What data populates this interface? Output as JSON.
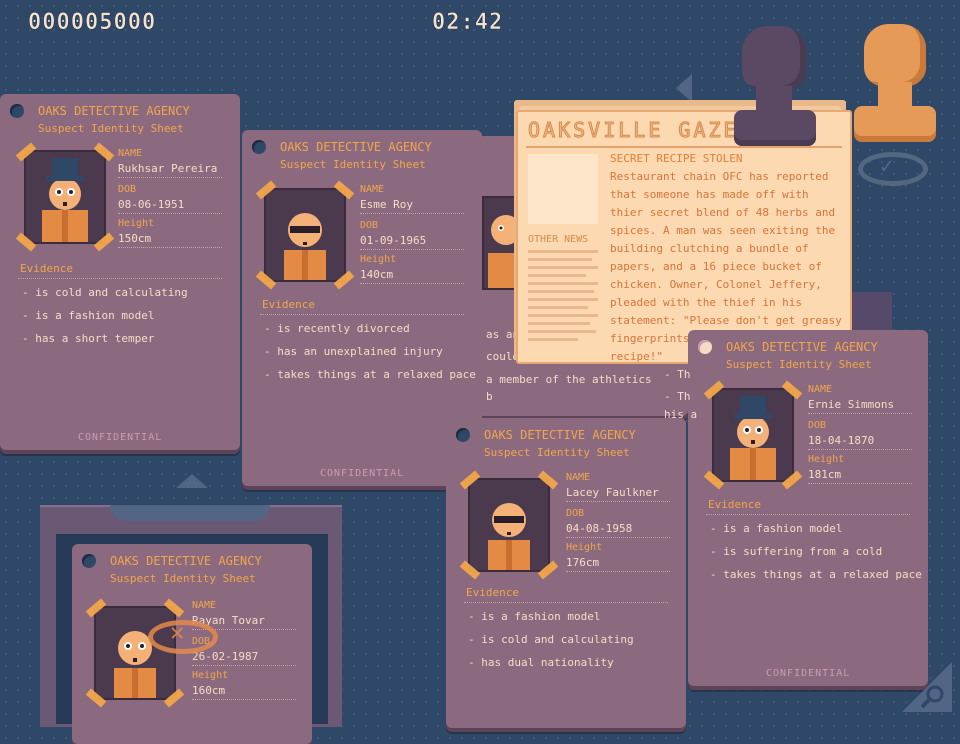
{
  "hud": {
    "score": "000005000",
    "timer": "02:42"
  },
  "colors": {
    "background": "#2f4868",
    "card": "#8b6a80",
    "accent": "#f2a64a",
    "paper": "#fcd9b0"
  },
  "field_labels": {
    "name": "NAME",
    "dob": "DOB",
    "height": "Height",
    "evidence": "Evidence",
    "confidential": "CONFIDENTIAL"
  },
  "cards": [
    {
      "agency": "OAKS DETECTIVE AGENCY",
      "subtitle": "Suspect Identity Sheet",
      "name": "Rukhsar Pereira",
      "dob": "08-06-1951",
      "height": "150cm",
      "evidence": [
        "- is cold and calculating",
        "- is a fashion model",
        "- has a short temper"
      ],
      "suspect": "top-hat"
    },
    {
      "agency": "OAKS DETECTIVE AGENCY",
      "subtitle": "Suspect Identity Sheet",
      "name": "Esme Roy",
      "dob": "01-09-1965",
      "height": "140cm",
      "evidence": [
        "- is recently divorced",
        "- has an unexplained injury",
        "- takes things at a relaxed pace"
      ],
      "suspect": "sunglasses"
    },
    {
      "agency": "OAKS DETECTIVE AGENCY",
      "subtitle": "Suspect Identity Sheet",
      "name": "Ernie Simmons",
      "dob": "18-04-1870",
      "height": "181cm",
      "evidence": [
        "- is a fashion model",
        "- is suffering from a cold",
        "- takes things at a relaxed pace"
      ],
      "suspect": "top-hat"
    },
    {
      "agency": "OAKS DETECTIVE AGENCY",
      "subtitle": "Suspect Identity Sheet",
      "name": "Lacey Faulkner",
      "dob": "04-08-1958",
      "height": "176cm",
      "evidence": [
        "- is a fashion model",
        "- is cold and calculating",
        "- has dual nationality"
      ],
      "suspect": "sunglasses"
    },
    {
      "agency": "OAKS DETECTIVE AGENCY",
      "subtitle": "Suspect Identity Sheet",
      "name": "Rayan Tovar",
      "dob": "26-02-1987",
      "height": "160cm",
      "evidence": [],
      "suspect": "bald"
    }
  ],
  "hidden_card": {
    "evidence_fragments": [
      "as an",
      "could",
      "a member of the athletics",
      "b"
    ]
  },
  "newspaper": {
    "masthead": "OAKSVILLE GAZETTE",
    "headline": "SECRET RECIPE STOLEN",
    "article": "Restaurant chain OFC has reported that someone has made off with thier secret blend of 48 herbs and spices. A man was seen exiting the building clutching a bundle of papers, and a 16 piece bucket of chicken. Owner, Colonel Jeffery, pleaded with the thief in his statement: \"Please don't get greasy fingerprints all over my fathers recipe!\"",
    "other_news": "OTHER NEWS"
  },
  "right_fragments": [
    "- Th",
    "- Th",
    "his a"
  ],
  "stamps": {
    "reject": "reject-stamp",
    "approve": "approve-stamp"
  }
}
